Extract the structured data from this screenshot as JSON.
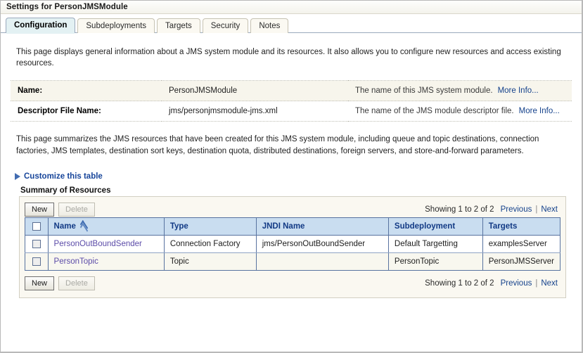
{
  "titlebar": {
    "title": "Settings for PersonJMSModule"
  },
  "tabs": [
    {
      "label": "Configuration",
      "active": true
    },
    {
      "label": "Subdeployments",
      "active": false
    },
    {
      "label": "Targets",
      "active": false
    },
    {
      "label": "Security",
      "active": false
    },
    {
      "label": "Notes",
      "active": false
    }
  ],
  "intro": {
    "text": "This page displays general information about a JMS system module and its resources. It also allows you to configure new resources and access existing resources."
  },
  "info_rows": [
    {
      "label": "Name:",
      "value": "PersonJMSModule",
      "description": "The name of this JMS system module.",
      "more_info": "More Info..."
    },
    {
      "label": "Descriptor File Name:",
      "value": "jms/personjmsmodule-jms.xml",
      "description": "The name of the JMS module descriptor file.",
      "more_info": "More Info..."
    }
  ],
  "summary_paragraph": {
    "text": "This page summarizes the JMS resources that have been created for this JMS system module, including queue and topic destinations, connection factories, JMS templates, destination sort keys, destination quota, distributed destinations, foreign servers, and store-and-forward parameters."
  },
  "customize": {
    "label": "Customize this table"
  },
  "panel": {
    "title": "Summary of Resources",
    "toolbar": {
      "new_label": "New",
      "delete_label": "Delete"
    },
    "pager": {
      "count": "Showing 1 to 2 of 2",
      "previous": "Previous",
      "separator": "|",
      "next": "Next"
    },
    "table": {
      "columns": [
        "Name",
        "Type",
        "JNDI Name",
        "Subdeployment",
        "Targets"
      ],
      "sorted_column": "Name",
      "sort_direction": "ascending",
      "rows": [
        {
          "name": "PersonOutBoundSender",
          "type": "Connection Factory",
          "jndi_name": "jms/PersonOutBoundSender",
          "subdeployment": "Default Targetting",
          "targets": "examplesServer"
        },
        {
          "name": "PersonTopic",
          "type": "Topic",
          "jndi_name": "",
          "subdeployment": "PersonTopic",
          "targets": "PersonJMSServer"
        }
      ]
    }
  },
  "colors": {
    "link": "#14418b",
    "row_link": "#5b4ba8",
    "header_bg": "#c9ddf0",
    "header_text": "#123a85",
    "panel_bg": "#faf8f1",
    "active_tab_bg": "#e3f1f3"
  }
}
